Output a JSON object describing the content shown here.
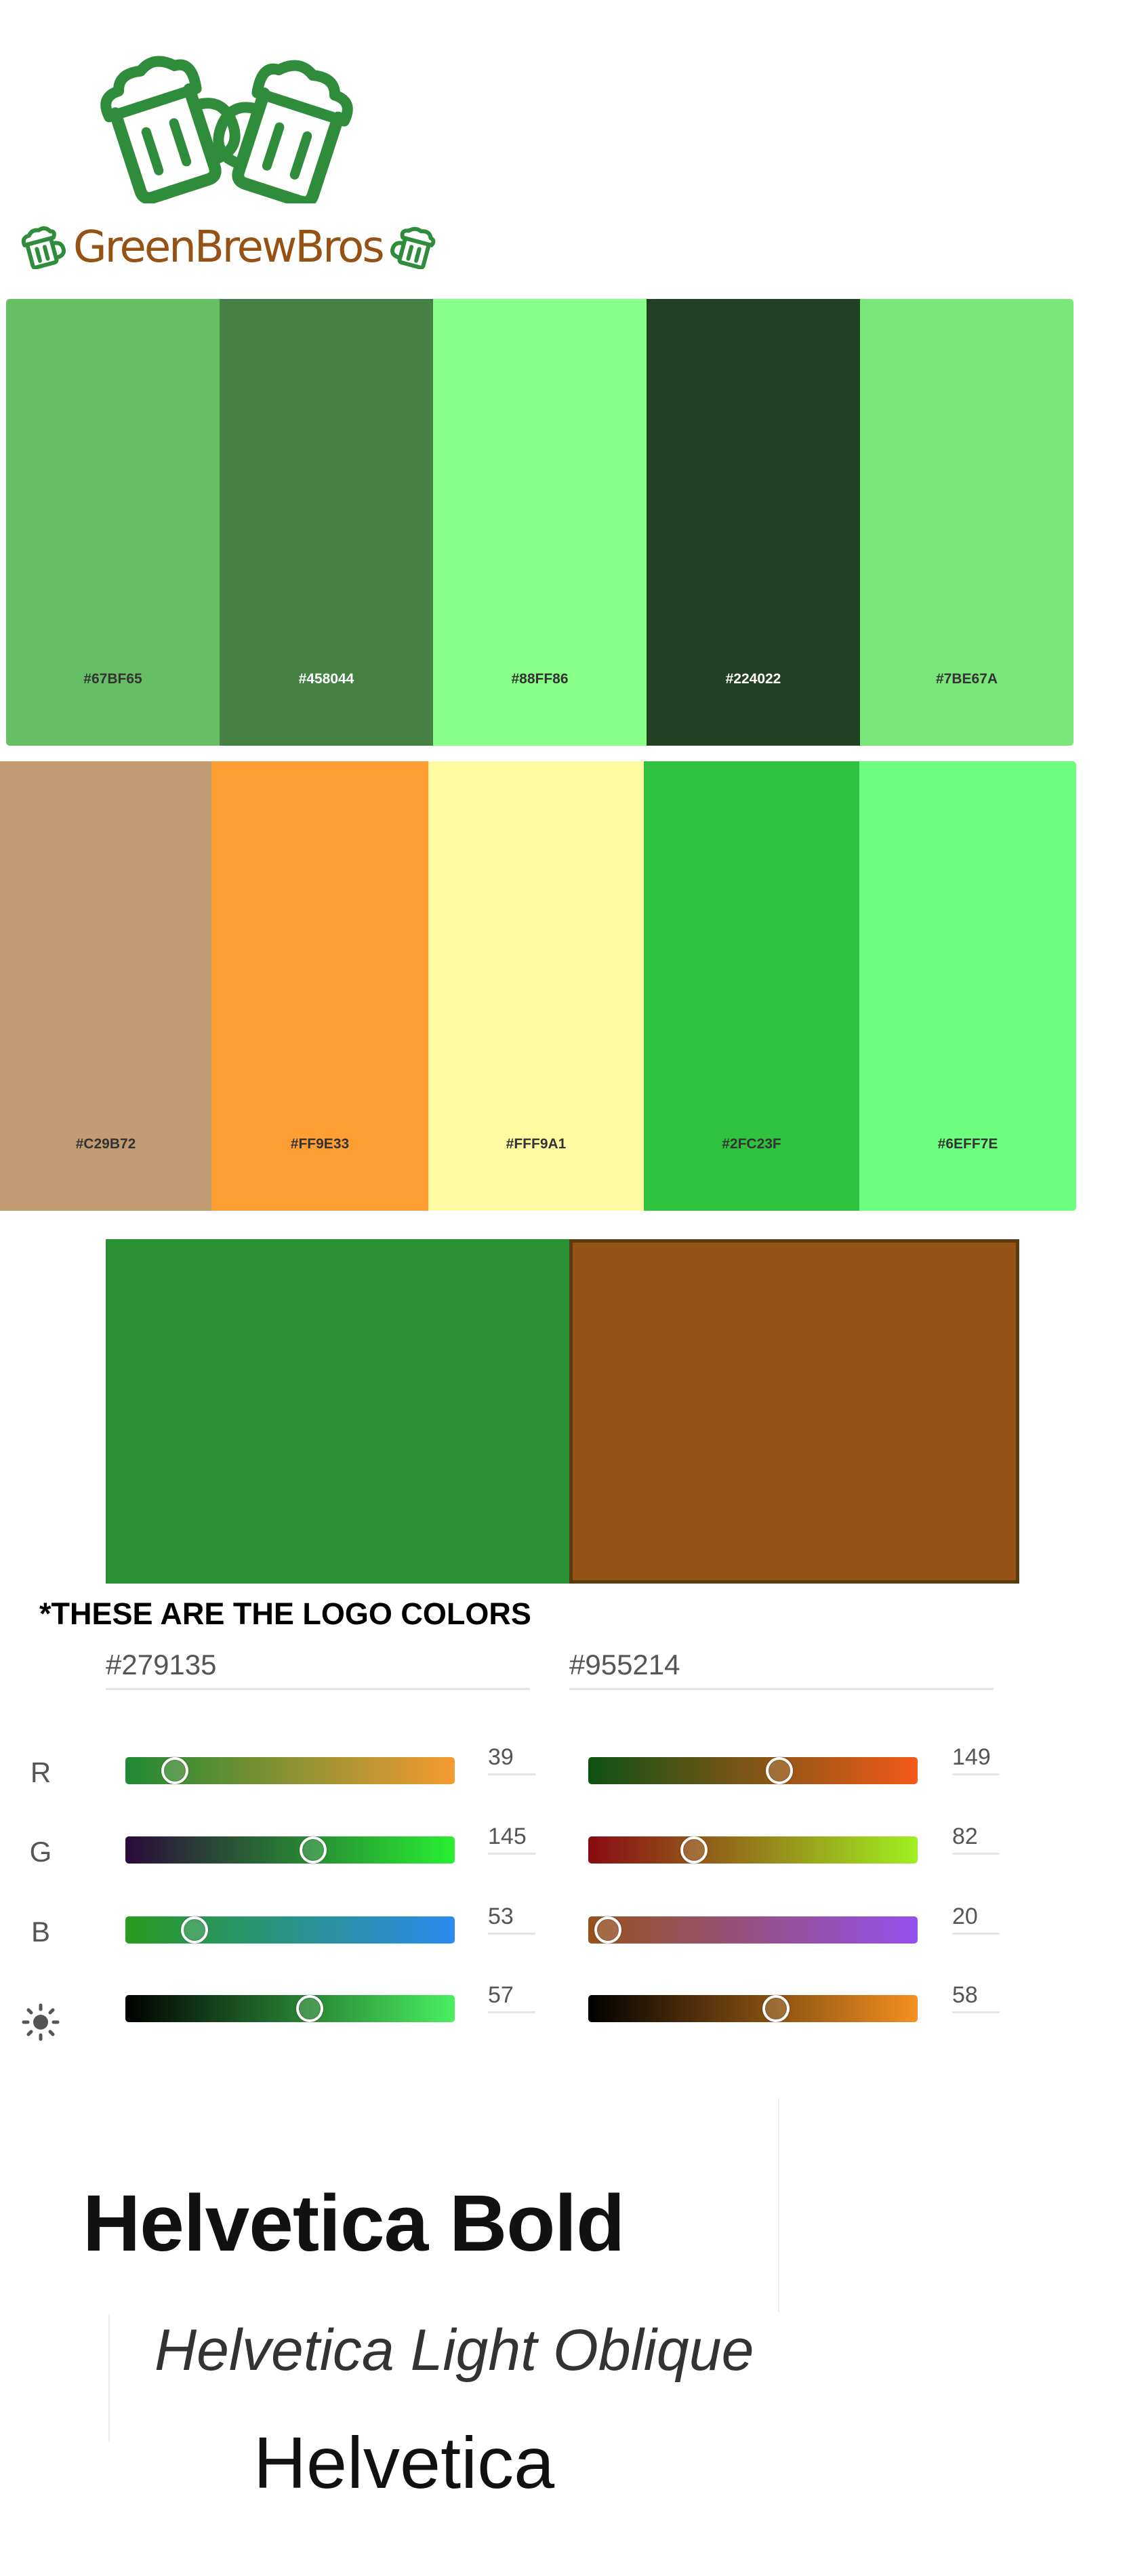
{
  "logo": {
    "wordmark": "GreenBrewBros",
    "mark_color": "#2f8c3a",
    "wordmark_color": "#955214"
  },
  "palettes": [
    {
      "swatches": [
        {
          "hex": "#67BF65",
          "label": "#67BF65",
          "text_color": "#333333"
        },
        {
          "hex": "#458044",
          "label": "#458044",
          "text_color": "#ffffff"
        },
        {
          "hex": "#88FF86",
          "label": "#88FF86",
          "text_color": "#333333"
        },
        {
          "hex": "#224022",
          "label": "#224022",
          "text_color": "#ffffff"
        },
        {
          "hex": "#7BE67A",
          "label": "#7BE67A",
          "text_color": "#333333"
        }
      ]
    },
    {
      "swatches": [
        {
          "hex": "#C29B72",
          "label": "#C29B72",
          "text_color": "#333333"
        },
        {
          "hex": "#FF9E33",
          "label": "#FF9E33",
          "text_color": "#333333"
        },
        {
          "hex": "#FFF9A1",
          "label": "#FFF9A1",
          "text_color": "#333333"
        },
        {
          "hex": "#2FC23F",
          "label": "#2FC23F",
          "text_color": "#333333"
        },
        {
          "hex": "#6EFF7E",
          "label": "#6EFF7E",
          "text_color": "#333333"
        }
      ]
    }
  ],
  "logo_colors": {
    "note": "*THESE ARE THE LOGO COLORS",
    "left": {
      "swatch": "#2A9135",
      "hex": "#279135",
      "channels": [
        {
          "label": "R",
          "value": "39",
          "fraction": 0.15,
          "gradient": [
            "#1f8a34",
            "#f59a30"
          ]
        },
        {
          "label": "G",
          "value": "145",
          "fraction": 0.57,
          "gradient": [
            "#2a0a3a",
            "#28f030"
          ]
        },
        {
          "label": "B",
          "value": "53",
          "fraction": 0.21,
          "gradient": [
            "#2a9a20",
            "#2a8cf0"
          ]
        },
        {
          "label": "",
          "value": "57",
          "fraction": 0.56,
          "gradient": [
            "#000000",
            "#4af060"
          ]
        }
      ]
    },
    "right": {
      "swatch": "#955214",
      "hex": "#955214",
      "channels": [
        {
          "label": "R",
          "value": "149",
          "fraction": 0.58,
          "gradient": [
            "#0e5214",
            "#f55a18"
          ]
        },
        {
          "label": "G",
          "value": "82",
          "fraction": 0.32,
          "gradient": [
            "#8a0a14",
            "#a0f020"
          ]
        },
        {
          "label": "B",
          "value": "20",
          "fraction": 0.06,
          "gradient": [
            "#96521a",
            "#9650f0"
          ]
        },
        {
          "label": "",
          "value": "58",
          "fraction": 0.57,
          "gradient": [
            "#000000",
            "#f59020"
          ]
        }
      ]
    },
    "brightness_icon": "sun-icon"
  },
  "fonts": {
    "bold": "Helvetica Bold",
    "light_oblique": "Helvetica Light Oblique",
    "regular": "Helvetica"
  }
}
